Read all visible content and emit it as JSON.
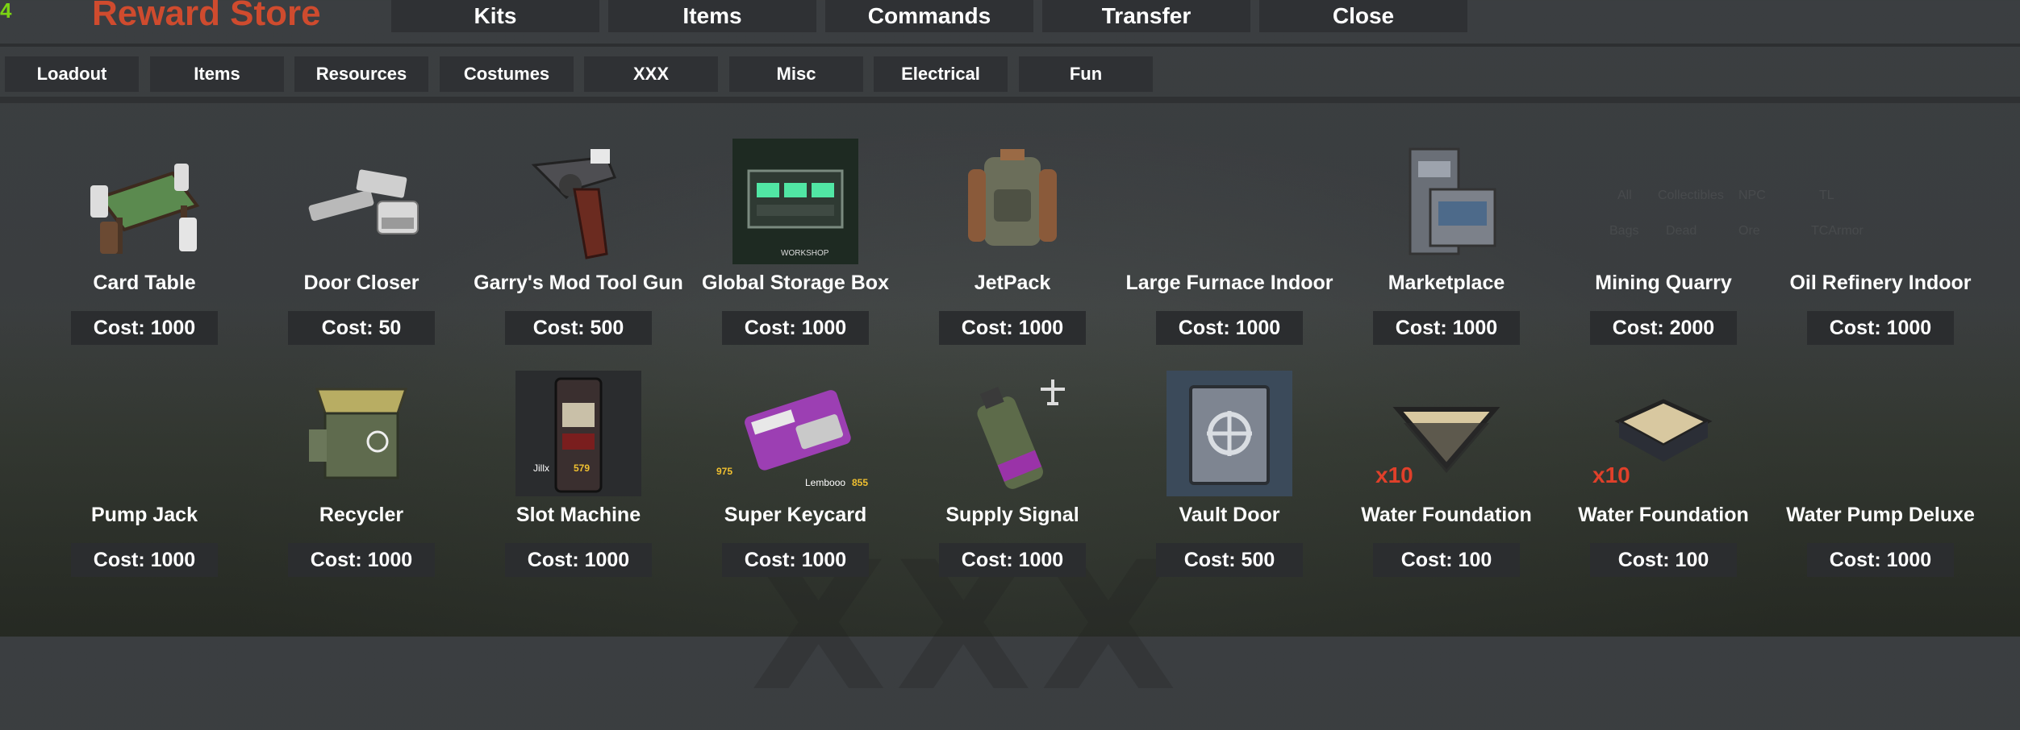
{
  "counter": "4",
  "title": "Reward Store",
  "top_nav": [
    "Kits",
    "Items",
    "Commands",
    "Transfer",
    "Close"
  ],
  "categories": [
    "Loadout",
    "Items",
    "Resources",
    "Costumes",
    "XXX",
    "Misc",
    "Electrical",
    "Fun"
  ],
  "items": [
    {
      "name": "Card Table",
      "cost": "Cost: 1000",
      "icon": "card-table-icon"
    },
    {
      "name": "Door Closer",
      "cost": "Cost: 50",
      "icon": "door-closer-icon"
    },
    {
      "name": "Garry's Mod Tool Gun",
      "cost": "Cost: 500",
      "icon": "tool-gun-icon"
    },
    {
      "name": "Global Storage Box",
      "cost": "Cost: 1000",
      "icon": "storage-box-icon",
      "img_caption": "WORKSHOP"
    },
    {
      "name": "JetPack",
      "cost": "Cost: 1000",
      "icon": "jetpack-icon"
    },
    {
      "name": "Large Furnace Indoor",
      "cost": "Cost: 1000",
      "icon": "large-furnace-icon"
    },
    {
      "name": "Marketplace",
      "cost": "Cost: 1000",
      "icon": "marketplace-icon"
    },
    {
      "name": "Mining Quarry",
      "cost": "Cost: 2000",
      "icon": "mining-quarry-icon"
    },
    {
      "name": "Oil Refinery Indoor",
      "cost": "Cost: 1000",
      "icon": "oil-refinery-icon"
    },
    {
      "name": "Pump Jack",
      "cost": "Cost: 1000",
      "icon": "pump-jack-icon"
    },
    {
      "name": "Recycler",
      "cost": "Cost: 1000",
      "icon": "recycler-icon"
    },
    {
      "name": "Slot Machine",
      "cost": "Cost: 1000",
      "icon": "slot-machine-icon",
      "img_caption": "Jillx",
      "img_caption_num": "579"
    },
    {
      "name": "Super Keycard",
      "cost": "Cost: 1000",
      "icon": "keycard-icon",
      "img_caption": "Lembooo",
      "img_caption_num": "855",
      "img_caption_left": "975"
    },
    {
      "name": "Supply Signal",
      "cost": "Cost: 1000",
      "icon": "supply-signal-icon"
    },
    {
      "name": "Vault Door",
      "cost": "Cost: 500",
      "icon": "vault-door-icon"
    },
    {
      "name": "Water Foundation",
      "cost": "Cost: 100",
      "icon": "triangle-foundation-icon",
      "badge": "x10"
    },
    {
      "name": "Water Foundation",
      "cost": "Cost: 100",
      "icon": "square-foundation-icon",
      "badge": "x10"
    },
    {
      "name": "Water Pump Deluxe",
      "cost": "Cost: 1000",
      "icon": "water-pump-icon"
    }
  ],
  "colors": {
    "title": "#cf4b2e",
    "counter": "#7bd313",
    "button_bg": "#2f3134",
    "cost_bg": "#2b2d2f",
    "badge": "#e0402a"
  }
}
